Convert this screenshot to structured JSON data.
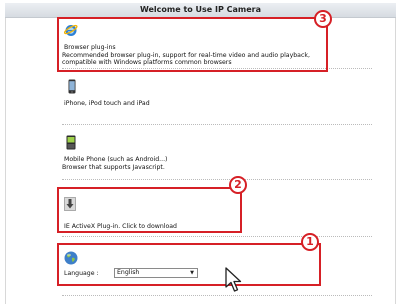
{
  "header": {
    "title": "Welcome to Use IP Camera"
  },
  "sections": {
    "browser_plugin": {
      "title": "Browser plug-ins",
      "desc_line1": "Recommended browser plug-in, support for real-time video and audio playback,",
      "desc_line2": "compatible with Windows platforms common browsers"
    },
    "ios": {
      "title": "iPhone, iPod touch and iPad"
    },
    "mobile": {
      "title": "Mobile Phone (such as Android...)",
      "desc": "Browser that supports Javascript."
    },
    "activex": {
      "title": "IE ActiveX Plug-in. Click to download"
    },
    "language": {
      "label": "Language :",
      "selected": "English"
    }
  },
  "badges": {
    "one": "1",
    "two": "2",
    "three": "3"
  },
  "icons": {
    "browser": "ie-icon",
    "ios": "iphone-icon",
    "mobile": "mobile-phone-icon",
    "activex": "download-icon",
    "language": "globe-icon",
    "cursor": "mouse-cursor-icon"
  },
  "colors": {
    "highlight": "#d62026",
    "header_bg": "#dfe3e8"
  }
}
